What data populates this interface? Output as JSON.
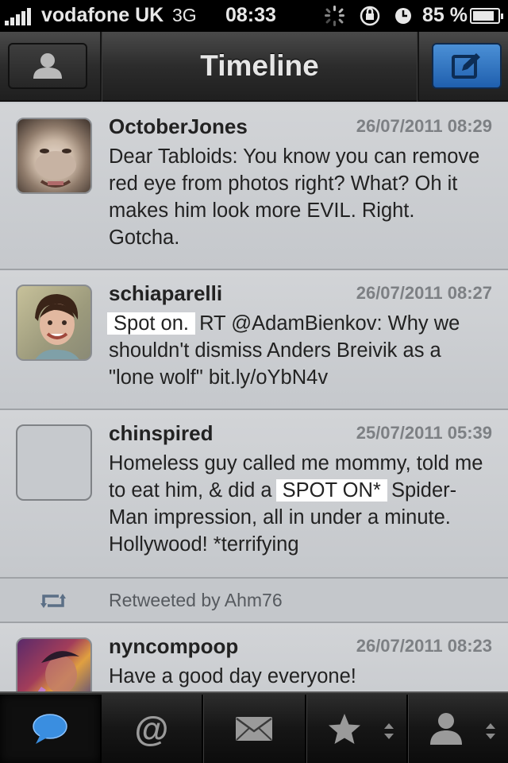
{
  "status_bar": {
    "carrier": "vodafone UK",
    "network": "3G",
    "time": "08:33",
    "battery": "85 %",
    "battery_level": 0.85
  },
  "nav": {
    "title": "Timeline",
    "left_button_icon": "user-icon",
    "right_button_icon": "compose-icon"
  },
  "tweets": [
    {
      "user": "OctoberJones",
      "date": "26/07/2011 08:29",
      "text": "Dear Tabloids: You know you can remove red eye from photos right? What? Oh it makes him look more EVIL. Right. Gotcha."
    },
    {
      "user": "schiaparelli",
      "date": "26/07/2011 08:27",
      "highlight": "Spot on.",
      "text_rest": " RT @AdamBienkov: Why we shouldn't dismiss Anders Breivik as a \"lone wolf\" bit.ly/oYbN4v"
    },
    {
      "user": "chinspired",
      "date": "25/07/2011 05:39",
      "text_before": "Homeless guy called me mommy, told me to eat him, & did a ",
      "highlight": "SPOT ON*",
      "text_after": " Spider-Man impression, all in under a minute. Hollywood! *terrifying"
    },
    {
      "retweeted_by": "Retweeted by Ahm76"
    },
    {
      "user": "nyncompoop",
      "date": "26/07/2011 08:23",
      "text": "Have a good day everyone!"
    }
  ],
  "tabs": [
    {
      "icon": "speech-bubble-icon",
      "selected": true
    },
    {
      "icon": "at-sign-icon"
    },
    {
      "icon": "envelope-icon"
    },
    {
      "icon": "star-icon"
    },
    {
      "icon": "profile-icon"
    }
  ],
  "colors": {
    "accent_blue": "#2f74c4",
    "cell_bg": "#c9ccd0",
    "highlight": "#ffffff"
  }
}
